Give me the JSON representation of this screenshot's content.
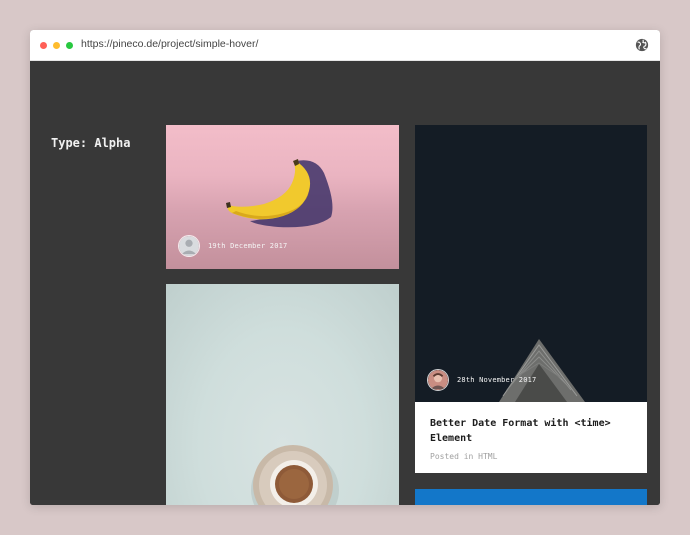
{
  "browser": {
    "url": "https://pineco.de/project/simple-hover/",
    "dot_colors": [
      "#ff5f57",
      "#febc2e",
      "#28c840"
    ]
  },
  "page": {
    "title": "Type: Alpha"
  },
  "cards": [
    {
      "date": "19th December 2017"
    },
    {
      "date": "28th November 2017",
      "title": "Better Date Format with <time> Element",
      "subtitle": "Posted in HTML"
    }
  ],
  "colors": {
    "page_bg": "#383838",
    "blue_card": "#1377c9"
  }
}
